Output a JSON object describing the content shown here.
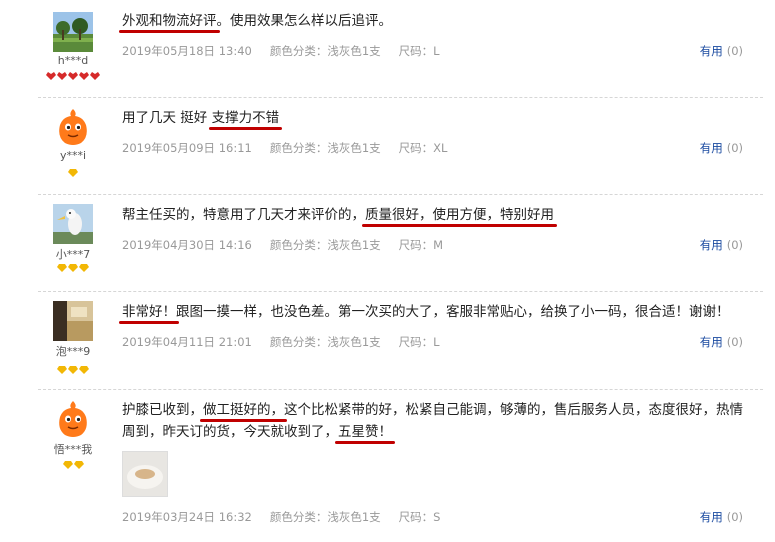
{
  "colors": {
    "underline": "#c00000",
    "link": "#1a4aa0",
    "meta": "#999999"
  },
  "reviews": [
    {
      "username": "h***d",
      "content_segments": [
        {
          "text": "外观和物流好评",
          "underline": true
        },
        {
          "text": "。使用效果怎么样以后追评。",
          "underline": false
        }
      ],
      "date": "2019年05月18日 13:40",
      "color": "颜色分类：浅灰色1支",
      "size": "尺码：L",
      "useful_label": "有用",
      "useful_count": "(0)",
      "level_icon": "red-heart-gem-icon",
      "level_count": 5
    },
    {
      "username": "y***i",
      "content_segments": [
        {
          "text": "用了几天 挺好 ",
          "underline": false
        },
        {
          "text": "支撑力不错",
          "underline": true
        }
      ],
      "date": "2019年05月09日 16:11",
      "color": "颜色分类：浅灰色1支",
      "size": "尺码：XL",
      "useful_label": "有用",
      "useful_count": "(0)",
      "level_icon": "yellow-diamond-icon",
      "level_count": 1
    },
    {
      "username": "小***7",
      "content_segments": [
        {
          "text": "帮主任买的，特意用了几天才来评价的，",
          "underline": false
        },
        {
          "text": "质量很好，使用方便，特别好用",
          "underline": true
        }
      ],
      "date": "2019年04月30日 14:16",
      "color": "颜色分类：浅灰色1支",
      "size": "尺码：M",
      "useful_label": "有用",
      "useful_count": "(0)",
      "level_icon": "yellow-diamond-icon",
      "level_count": 3
    },
    {
      "username": "泡***9",
      "content_segments": [
        {
          "text": "非常好！",
          "underline": true
        },
        {
          "text": "跟图一摸一样，也没色差。第一次买的大了，客服非常贴心，给换了小一码，很合适！谢谢！",
          "underline": false
        }
      ],
      "date": "2019年04月11日 21:01",
      "color": "颜色分类：浅灰色1支",
      "size": "尺码：L",
      "useful_label": "有用",
      "useful_count": "(0)",
      "level_icon": "yellow-diamond-icon",
      "level_count": 3
    },
    {
      "username": "悟***我",
      "content_segments": [
        {
          "text": "护膝已收到，",
          "underline": false
        },
        {
          "text": "做工挺好的，",
          "underline": true
        },
        {
          "text": "这个比松紧带的好，松紧自己能调，够薄的，售后服务人员，态度很好，热情周到，昨天订的货，今天就收到了，",
          "underline": false
        },
        {
          "text": "五星赞！",
          "underline": true
        }
      ],
      "date": "2019年03月24日 16:32",
      "color": "颜色分类：浅灰色1支",
      "size": "尺码：S",
      "useful_label": "有用",
      "useful_count": "(0)",
      "level_icon": "yellow-diamond-icon",
      "level_count": 2
    }
  ]
}
